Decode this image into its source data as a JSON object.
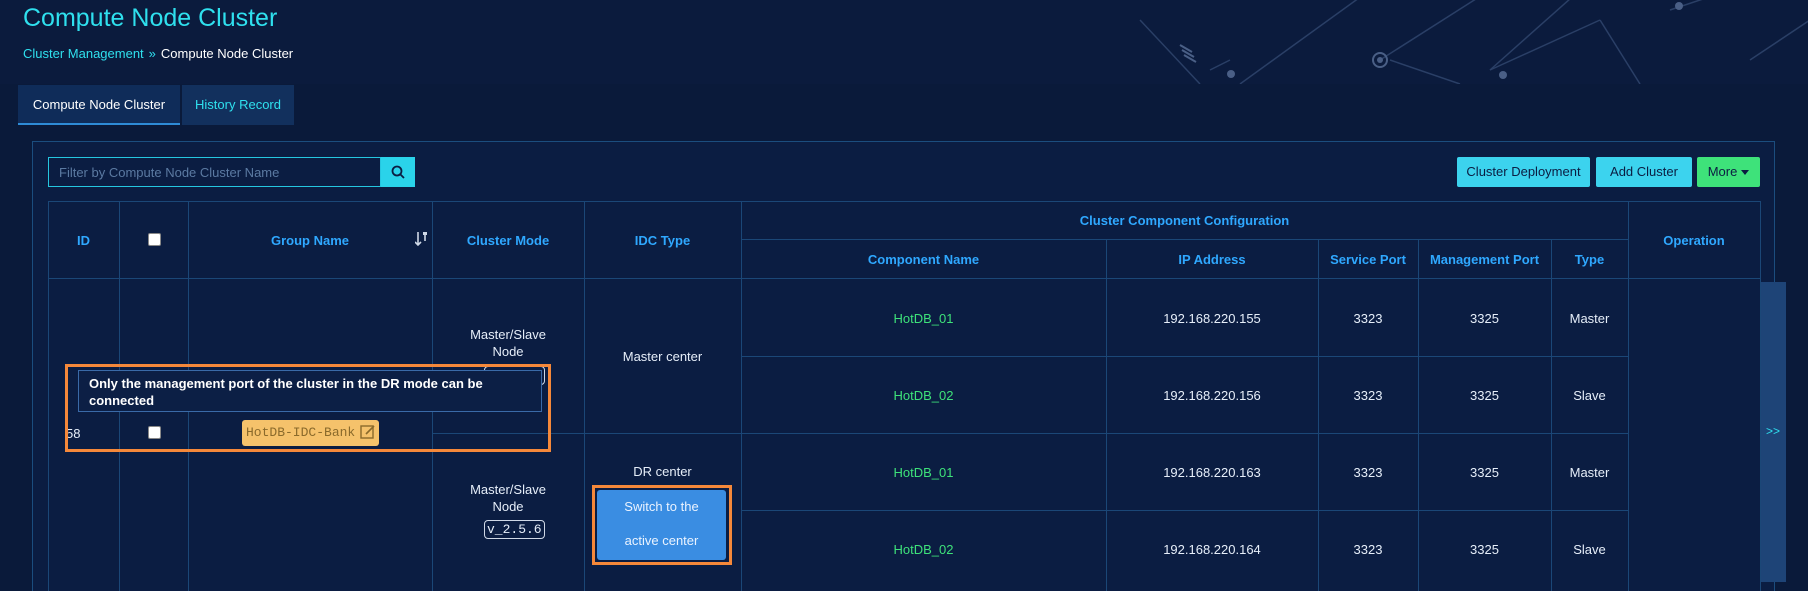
{
  "page": {
    "title": "Compute Node Cluster",
    "breadcrumb": {
      "parent": "Cluster Management",
      "separator": "»",
      "current": "Compute Node Cluster"
    }
  },
  "tabs": [
    {
      "label": "Compute Node Cluster",
      "active": true
    },
    {
      "label": "History Record",
      "active": false
    }
  ],
  "toolbar": {
    "search_placeholder": "Filter by Compute Node Cluster Name",
    "deploy_label": "Cluster Deployment",
    "add_label": "Add Cluster",
    "more_label": "More"
  },
  "table": {
    "headers": {
      "id": "ID",
      "group_name": "Group Name",
      "cluster_mode": "Cluster Mode",
      "idc_type": "IDC Type",
      "component_config": "Cluster Component Configuration",
      "component_name": "Component Name",
      "ip_address": "IP Address",
      "service_port": "Service Port",
      "management_port": "Management Port",
      "type": "Type",
      "operation": "Operation"
    },
    "group": {
      "id": "58",
      "group_name": "HotDB-IDC-Bank",
      "master_mode": "Master/Slave Node",
      "dr_mode": "Master/Slave Node",
      "master_version": "v_2.5.6",
      "dr_version": "v_2.5.6",
      "master_idc": "Master center",
      "dr_idc": "DR center",
      "switch_label_1": "Switch to the",
      "switch_label_2": "active center"
    },
    "rows": [
      {
        "name": "HotDB_01",
        "ip": "192.168.220.155",
        "service_port": "3323",
        "management_port": "3325",
        "type": "Master"
      },
      {
        "name": "HotDB_02",
        "ip": "192.168.220.156",
        "service_port": "3323",
        "management_port": "3325",
        "type": "Slave"
      },
      {
        "name": "HotDB_01",
        "ip": "192.168.220.163",
        "service_port": "3323",
        "management_port": "3325",
        "type": "Master"
      },
      {
        "name": "HotDB_02",
        "ip": "192.168.220.164",
        "service_port": "3323",
        "management_port": "3325",
        "type": "Slave"
      }
    ]
  },
  "tooltip": {
    "line1": "Only the management port of the cluster in the DR mode can be",
    "line2": "connected"
  },
  "expand_label": ">>",
  "colors": {
    "accent": "#2fe0ee",
    "header_text": "#2fa8ff",
    "green": "#3ee27a",
    "highlight": "#f5883a"
  }
}
